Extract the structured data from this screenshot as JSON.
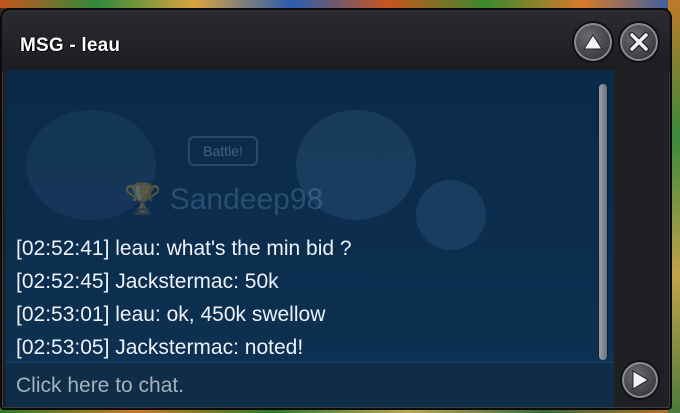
{
  "window": {
    "title": "MSG - leau"
  },
  "controls": {
    "up_icon": "triangle-up-icon",
    "close_icon": "close-x-icon",
    "send_icon": "triangle-right-icon"
  },
  "background_ghost": {
    "badge": "Battle!",
    "name": "Sandeep98"
  },
  "messages": [
    {
      "text": "[02:52:41] leau: what's the min bid ?"
    },
    {
      "text": "[02:52:45] Jackstermac: 50k"
    },
    {
      "text": "[02:53:01] leau: ok, 450k swellow"
    },
    {
      "text": "[02:53:05] Jackstermac: noted!"
    }
  ],
  "input": {
    "placeholder": "Click here to chat."
  },
  "colors": {
    "chat_bg": "#0c2d4e",
    "frame": "#1f2024",
    "text": "#eef2f6"
  }
}
